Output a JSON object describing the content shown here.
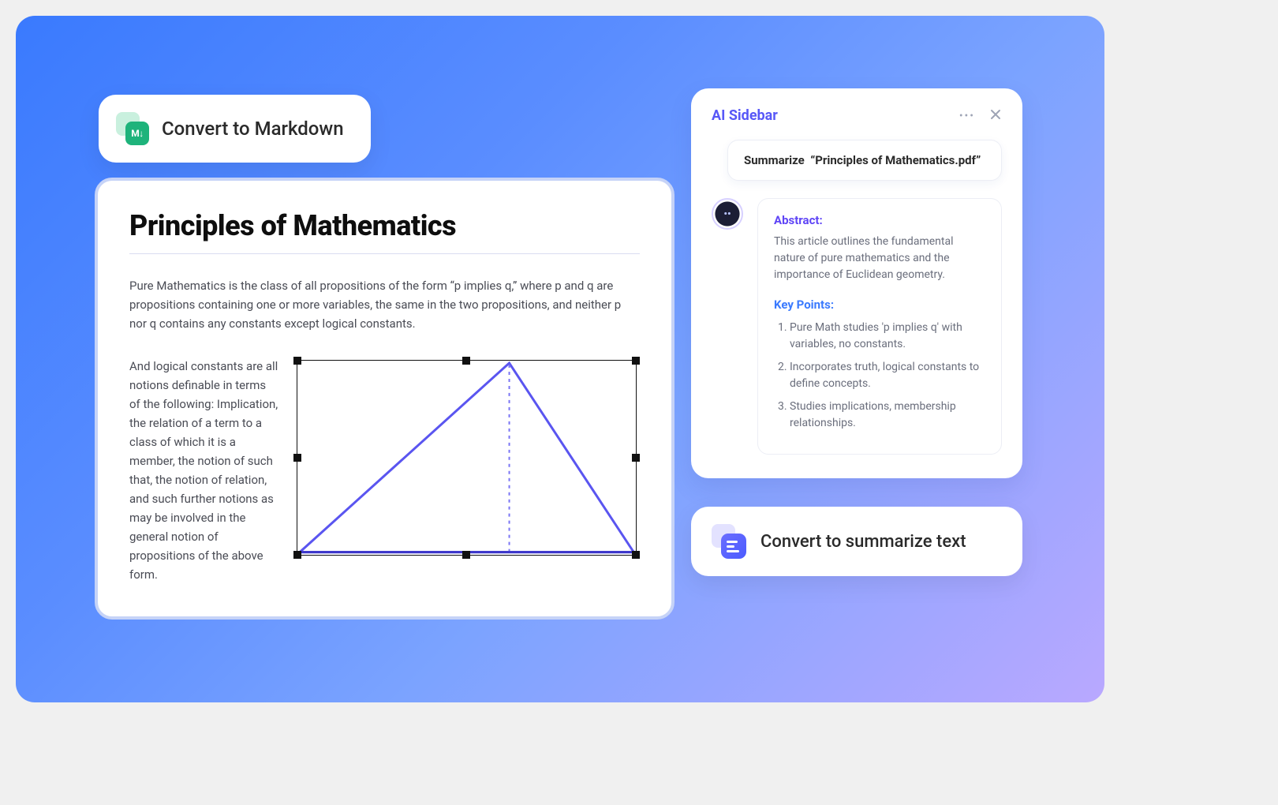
{
  "markdown_pill": {
    "label": "Convert to Markdown",
    "icon_text": "M↓"
  },
  "document": {
    "title": "Principles of Mathematics",
    "paragraph1": "Pure Mathematics is the class of all propositions of the form “p implies q,” where p and q are propositions containing one or more variables, the same in the two propositions, and neither p nor q contains any constants except logical constants.",
    "paragraph2": "And logical constants are all notions definable in terms of the following: Implication, the relation of a term to a class of which it is a member, the notion of such that, the notion of relation, and such further notions as may be involved in the general notion of propositions of the above form."
  },
  "ai_sidebar": {
    "title": "AI Sidebar",
    "prompt_prefix": "Summarize",
    "prompt_target": "“Principles of Mathematics.pdf”",
    "avatar_face": "••",
    "abstract_label": "Abstract:",
    "abstract_text": "This article outlines the fundamental nature of pure mathematics and the importance of Euclidean geometry.",
    "key_points_label": "Key Points:",
    "key_points": [
      "Pure Math studies 'p implies q' with variables, no constants.",
      "Incorporates truth, logical constants to define concepts.",
      "Studies implications, membership relationships."
    ]
  },
  "summarize_pill": {
    "label": "Convert to summarize text"
  }
}
